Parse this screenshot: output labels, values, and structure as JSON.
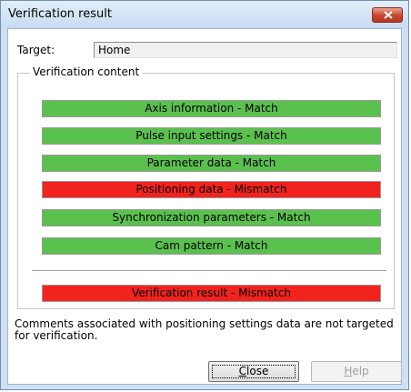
{
  "window": {
    "title": "Verification result"
  },
  "target": {
    "label": "Target:",
    "value": "Home"
  },
  "verification_content": {
    "label": "Verification content",
    "items": [
      {
        "text": "Axis information - Match",
        "status": "match"
      },
      {
        "text": "Pulse input settings - Match",
        "status": "match"
      },
      {
        "text": "Parameter data - Match",
        "status": "match"
      },
      {
        "text": "Positioning data - Mismatch",
        "status": "mismatch"
      },
      {
        "text": "Synchronization parameters - Match",
        "status": "match"
      },
      {
        "text": "Cam pattern - Match",
        "status": "match"
      }
    ],
    "result": {
      "text": "Verification result - Mismatch",
      "status": "mismatch"
    }
  },
  "comment": "Comments associated with positioning settings data are not targeted for verification.",
  "buttons": {
    "close_accel": "C",
    "close_rest": "lose",
    "help_accel": "H",
    "help_rest": "elp"
  },
  "colors": {
    "match": "#5bc14e",
    "mismatch": "#f2231d",
    "title_close_button": "#c9452c"
  },
  "icons": {
    "title_close": "close-icon"
  }
}
